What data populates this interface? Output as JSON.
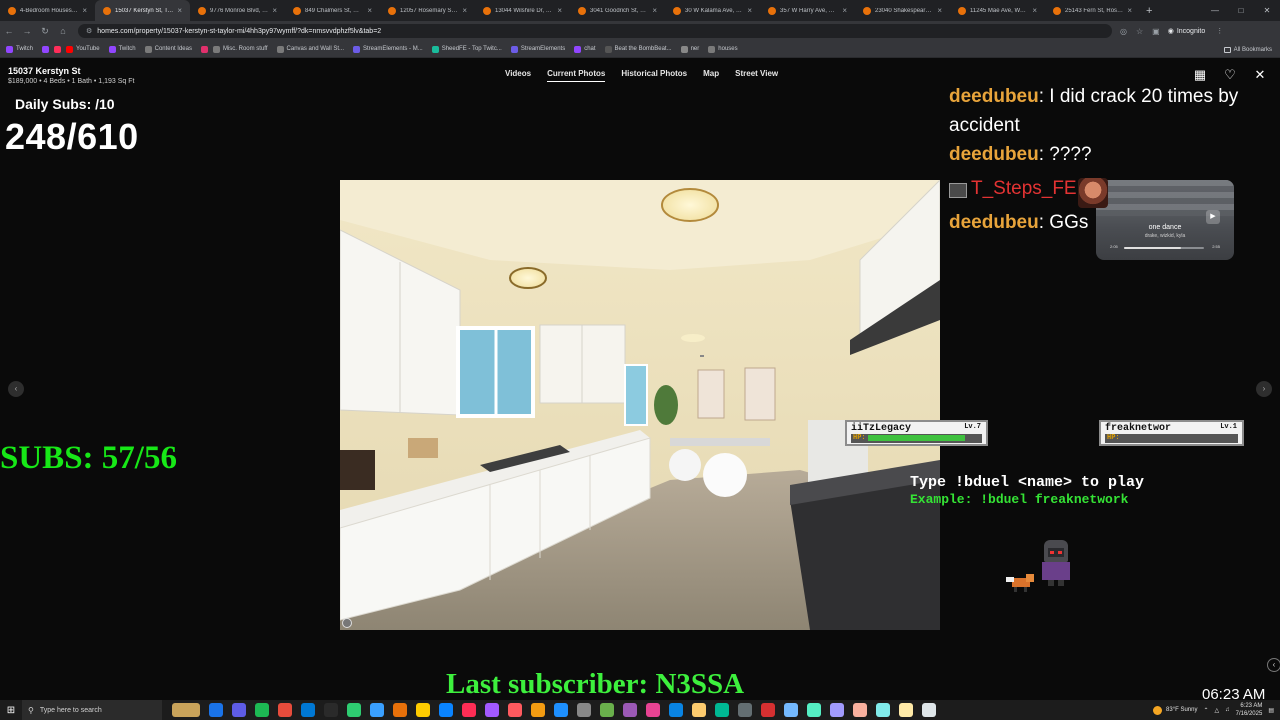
{
  "browser": {
    "tabs": [
      {
        "label": "4-Bedroom Houses ur",
        "color": "#e8710a",
        "active": false
      },
      {
        "label": "15037 Kerstyn St, Taylo",
        "color": "#e8710a",
        "active": true
      },
      {
        "label": "9776 Monroe Blvd, Tay",
        "color": "#e8710a",
        "active": false
      },
      {
        "label": "849 Chalmers St, Detro",
        "color": "#e8710a",
        "active": false
      },
      {
        "label": "12057 Rosemary St, Di",
        "color": "#e8710a",
        "active": false
      },
      {
        "label": "13044 Wilshire Dr, Det",
        "color": "#e8710a",
        "active": false
      },
      {
        "label": "3041 Goodrich St, Fern",
        "color": "#e8710a",
        "active": false
      },
      {
        "label": "30 W Kalama Ave, Mad",
        "color": "#e8710a",
        "active": false
      },
      {
        "label": "357 W Harry Ave, Haze",
        "color": "#e8710a",
        "active": false
      },
      {
        "label": "23040 Shakespeare Av",
        "color": "#e8710a",
        "active": false
      },
      {
        "label": "11245 Mae Ave, Warre",
        "color": "#e8710a",
        "active": false
      },
      {
        "label": "25143 Fern St, Rosevil",
        "color": "#e8710a",
        "active": false
      }
    ],
    "new_tab": "+",
    "url": "homes.com/property/15037-kerstyn-st-taylor-mi/4hh3py97wymff/?dk=nmsvvdphzf5lv&tab=2",
    "incognito_label": "Incognito",
    "bookmarks": [
      {
        "label": "Twitch",
        "color": "#9146ff"
      },
      {
        "label": "",
        "color": "#9146ff"
      },
      {
        "label": "",
        "color": "#ff2e5a"
      },
      {
        "label": "YouTube",
        "color": "#ff0000"
      },
      {
        "label": "Twitch",
        "color": "#9146ff"
      },
      {
        "label": "Content Ideas",
        "color": "#7a7a7a"
      },
      {
        "label": "",
        "color": "#e1306c"
      },
      {
        "label": "Misc. Room stuff",
        "color": "#7a7a7a"
      },
      {
        "label": "Canvas and Wall St...",
        "color": "#7a7a7a"
      },
      {
        "label": "StreamElements - M...",
        "color": "#6c5ce7"
      },
      {
        "label": "SheedFE - Top Twitc...",
        "color": "#1abc9c"
      },
      {
        "label": "StreamElements",
        "color": "#6c5ce7"
      },
      {
        "label": "chat",
        "color": "#9146ff"
      },
      {
        "label": "Beat the BombBeat...",
        "color": "#555555"
      },
      {
        "label": "ner",
        "color": "#888888"
      },
      {
        "label": "houses",
        "color": "#7a7a7a"
      }
    ],
    "all_bookmarks": "All Bookmarks"
  },
  "property": {
    "address": "15037 Kerstyn St",
    "meta": "$189,000  •  4 Beds  •  1 Bath  •  1,193 Sq Ft"
  },
  "gallery_tabs": [
    {
      "label": "Videos",
      "active": false
    },
    {
      "label": "Current Photos",
      "active": true
    },
    {
      "label": "Historical Photos",
      "active": false
    },
    {
      "label": "Map",
      "active": false
    },
    {
      "label": "Street View",
      "active": false
    }
  ],
  "overlay": {
    "daily_subs": "Daily Subs: /10",
    "big_count": "248/610",
    "subs_goal": "SUBS: 57/56",
    "last_subscriber": "Last subscriber: N3SSA"
  },
  "chat": [
    {
      "user": "deedubeu",
      "message": ": I did crack 20 times by accident",
      "user_color": "#e8a43b"
    },
    {
      "user": "deedubeu",
      "message": ": ????",
      "user_color": "#e8a43b"
    },
    {
      "user": "T_Steps_FE",
      "message": ":",
      "user_color": "#e33333"
    },
    {
      "user": "deedubeu",
      "message": ": GGs",
      "user_color": "#e8a43b"
    }
  ],
  "music": {
    "title": "one dance",
    "artist": "drake, wizkid, kyla",
    "elapsed": "2:05",
    "total": "2:55",
    "progress": 0.71
  },
  "duel": {
    "players": [
      {
        "name": "iiTzLegacy",
        "level": "Lv.7",
        "hp_label": "HP:",
        "hp": 0.85
      },
      {
        "name": "freaknetwor",
        "level": "Lv.1",
        "hp_label": "HP:",
        "hp": 0.0
      }
    ],
    "help_line1": "Type !bduel <name> to play",
    "help_line2": "Example: !bduel freaknetwork"
  },
  "taskbar": {
    "search_placeholder": "Type here to search",
    "weather": "83°F  Sunny",
    "time": "6:23 AM",
    "date": "7/16/2025",
    "big_time": "06:23 AM"
  }
}
